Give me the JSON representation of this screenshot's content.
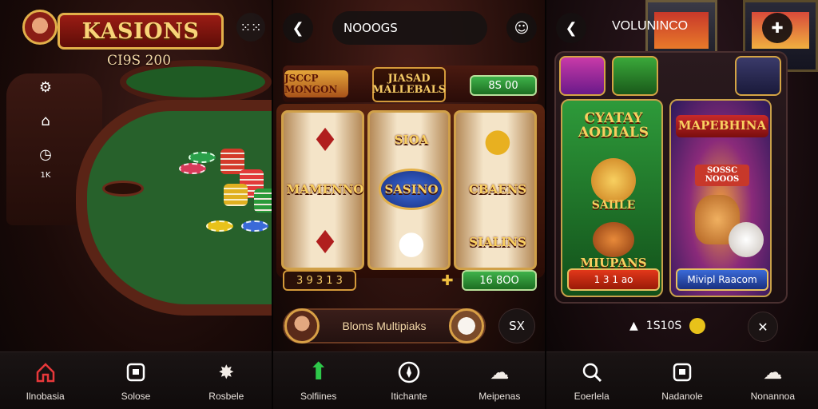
{
  "panel1": {
    "brand": "KASIONS",
    "subtitle": "CI9S 200",
    "grid_icon": "grid-icon",
    "side_count": "1K",
    "nav": [
      {
        "label": "Ilnobasia",
        "icon": "home-icon"
      },
      {
        "label": "Solose",
        "icon": "square-icon"
      },
      {
        "label": "Rosbele",
        "icon": "star-burst-icon"
      }
    ]
  },
  "panel2": {
    "search_value": "NOOOGS",
    "promo_left": "JSCCP MONGON",
    "promo_center": "JIASAD MALLEBALS",
    "credit": "8S 00",
    "reel_words": {
      "left": "MAMENNO",
      "center_top": "SIOA",
      "center_mid": "SASINO",
      "right_mid": "CBAENS",
      "right_bot": "SIALINS"
    },
    "bet_left": "3 9 3 1 3",
    "bet_right": "16 8OO",
    "player_text": "Bloms Multipiaks",
    "action_label": "SX",
    "nav": [
      {
        "label": "Solfiines",
        "icon": "arrow-up-icon"
      },
      {
        "label": "Itichante",
        "icon": "compass-icon"
      },
      {
        "label": "Meipenas",
        "icon": "cloud-icon"
      }
    ]
  },
  "panel3": {
    "title": "VOLUNINCO",
    "card_left_title": "CYATAY AODIALS",
    "card_left_mid": "SAIILE",
    "card_left_bottom": "MIUPANS",
    "card_left_btn": "1 3 1 ao",
    "card_right_title": "MAPEBHINA",
    "card_right_sub": "SOSSC NOOOS",
    "card_right_btn": "Mivipl Raacom",
    "win_amount": "1S10S",
    "nav": [
      {
        "label": "Eoerlela",
        "icon": "search-icon"
      },
      {
        "label": "Nadanole",
        "icon": "square-icon"
      },
      {
        "label": "Nonannoa",
        "icon": "cloud-icon"
      }
    ]
  },
  "colors": {
    "gold": "#e2b04a",
    "felt": "#27612b",
    "wood": "#5a2416",
    "green_button": "#2f9a3a",
    "red_button": "#c42618",
    "blue_button": "#2a58c8"
  }
}
